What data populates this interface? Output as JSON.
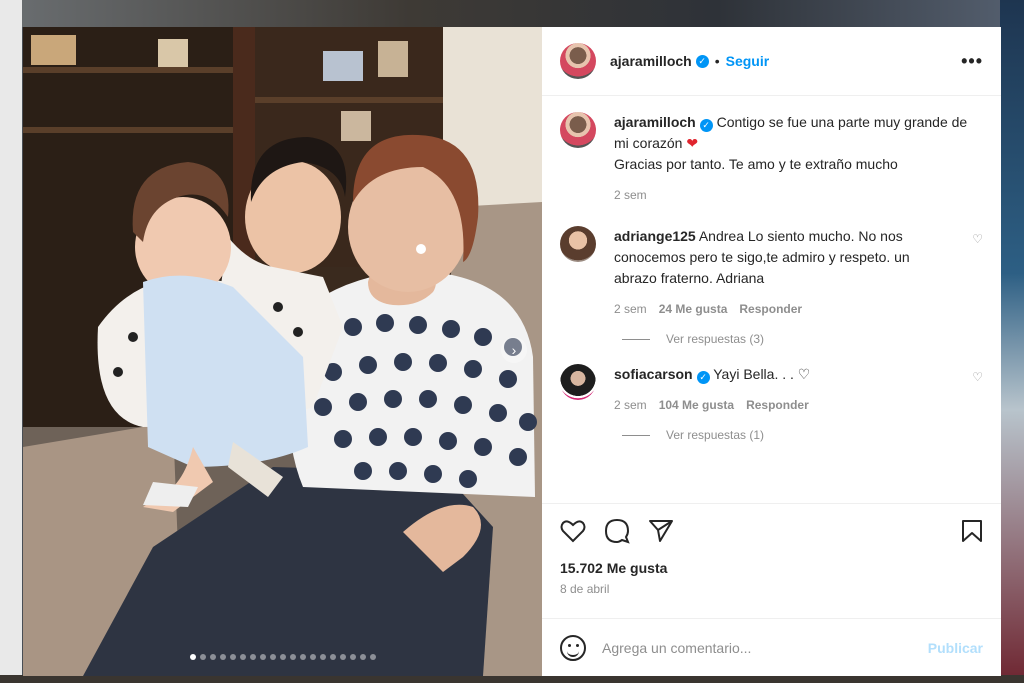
{
  "post": {
    "author": "ajaramilloch",
    "follow_label": "Seguir",
    "more_label": "•••",
    "separator": "•",
    "verified_mark": "✓"
  },
  "caption": {
    "user": "ajaramilloch",
    "text": "Contigo se fue una parte muy grande de mi corazón",
    "emoji": "❤",
    "line2": "Gracias por tanto. Te amo y te extraño mucho",
    "time": "2 sem"
  },
  "comments": [
    {
      "user": "adriange125",
      "text": "Andrea Lo siento mucho. No nos conocemos pero te sigo,te admiro y respeto. un abrazo fraterno. Adriana",
      "time": "2 sem",
      "likes": "24 Me gusta",
      "reply": "Responder",
      "view_replies": "Ver respuestas (3)"
    },
    {
      "user": "sofiacarson",
      "text": "Yayi Bella. . .",
      "emoji": "♡",
      "time": "2 sem",
      "likes": "104 Me gusta",
      "reply": "Responder",
      "view_replies": "Ver respuestas (1)"
    }
  ],
  "footer": {
    "likes": "15.702 Me gusta",
    "date": "8 de abril",
    "comment_placeholder": "Agrega un comentario...",
    "publish_label": "Publicar",
    "icons": [
      "heart-icon",
      "comment-icon",
      "share-icon",
      "bookmark-icon",
      "emoji-icon"
    ]
  },
  "carousel": {
    "slides": 19,
    "active_slide": 1
  },
  "colors": {
    "accent": "#0095f6",
    "muted": "#8e8e8e",
    "heart": "#e0242e"
  }
}
